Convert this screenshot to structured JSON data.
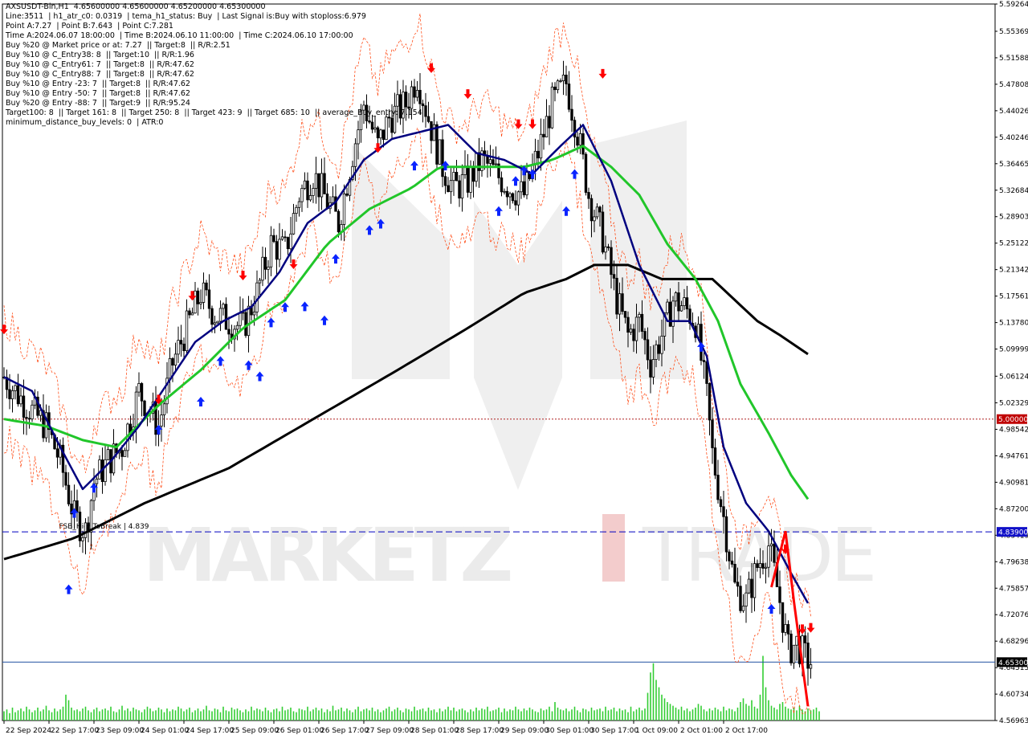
{
  "header_lines": [
    "AXSUSDT-Bin,H1  4.65600000 4.65600000 4.65200000 4.65300000",
    "Line:3511  | h1_atr_c0: 0.0319  | tema_h1_status: Buy  | Last Signal is:Buy with stoploss:6.979",
    "Point A:7.27  | Point B:7.643  | Point C:7.281",
    "Time A:2024.06.07 18:00:00  | Time B:2024.06.10 11:00:00  | Time C:2024.06.10 17:00:00",
    "Buy %20 @ Market price or at: 7.27  || Target:8  || R/R:2.51",
    "Buy %10 @ C_Entry38: 8  || Target:10  || R/R:1.96",
    "Buy %10 @ C_Entry61: 7  || Target:8  || R/R:47.62",
    "Buy %10 @ C_Entry88: 7  || Target:8  || R/R:47.62",
    "Buy %10 @ Entry -23: 7  || Target:8  || R/R:47.62",
    "Buy %10 @ Entry -50: 7  || Target:8  || R/R:47.62",
    "Buy %20 @ Entry -88: 7  || Target:9  || R/R:95.24",
    "Target100: 8  || Target 161: 8  || Target 250: 8  || Target 423: 9  || Target 685: 10  || average_Buy_entry: 7.154",
    "minimum_distance_buy_levels: 0  | ATR:0"
  ],
  "watermark": {
    "bold": "MARKETZ",
    "light": "TRADE"
  },
  "colors": {
    "background": "#ffffff",
    "grid": "#d6d6d6",
    "candle": "#000000",
    "ma_fast": "#00007f",
    "ma_mid": "#21c62a",
    "ma_slow": "#000000",
    "envelope": "#ff3b00",
    "volume": "#32cd32",
    "buy_arrow": "#0a24ff",
    "sell_arrow": "#ff0000",
    "level_5": "#b02020",
    "level_483": "#0000c0",
    "level_465": "#2050a0",
    "tag_red": "#c00000",
    "tag_blue": "#1010c8",
    "tag_black": "#000000",
    "zigzag": "#ff0000",
    "watermark": "#ebebeb",
    "watermark_accent": "#f3cccc"
  },
  "chart_data": {
    "type": "candlestick",
    "symbol": "AXSUSDT-Bin",
    "timeframe": "H1",
    "ylim": [
      4.56963,
      5.59264
    ],
    "y_ticks": [
      "5.59264",
      "5.55369",
      "5.51588",
      "5.47808",
      "5.44026",
      "5.40246",
      "5.36465",
      "5.32684",
      "5.28903",
      "5.25122",
      "5.21342",
      "5.17561",
      "5.13780",
      "5.09999",
      "5.06124",
      "5.02329",
      "4.98542",
      "4.94761",
      "4.90981",
      "4.87200",
      "4.83419",
      "4.79638",
      "4.75857",
      "4.72076",
      "4.68296",
      "4.64515",
      "4.60734",
      "4.56963"
    ],
    "x_ticks": [
      "22 Sep 2024",
      "22 Sep 17:00",
      "23 Sep 09:00",
      "24 Sep 01:00",
      "24 Sep 17:00",
      "25 Sep 09:00",
      "26 Sep 01:00",
      "26 Sep 17:00",
      "27 Sep 09:00",
      "28 Sep 01:00",
      "28 Sep 17:00",
      "29 Sep 09:00",
      "30 Sep 01:00",
      "30 Sep 17:00",
      "1 Oct 09:00",
      "2 Oct 01:00",
      "2 Oct 17:00"
    ],
    "price_path": [
      [
        0,
        5.06
      ],
      [
        8,
        5.02
      ],
      [
        15,
        4.99
      ],
      [
        20,
        4.94
      ],
      [
        25,
        4.86
      ],
      [
        29,
        4.84
      ],
      [
        32,
        4.91
      ],
      [
        37,
        4.94
      ],
      [
        42,
        4.96
      ],
      [
        48,
        5.04
      ],
      [
        55,
        4.99
      ],
      [
        60,
        5.08
      ],
      [
        65,
        5.13
      ],
      [
        70,
        5.18
      ],
      [
        75,
        5.15
      ],
      [
        80,
        5.14
      ],
      [
        85,
        5.13
      ],
      [
        90,
        5.18
      ],
      [
        95,
        5.25
      ],
      [
        100,
        5.24
      ],
      [
        105,
        5.32
      ],
      [
        110,
        5.35
      ],
      [
        115,
        5.31
      ],
      [
        119,
        5.28
      ],
      [
        124,
        5.38
      ],
      [
        128,
        5.45
      ],
      [
        133,
        5.39
      ],
      [
        137,
        5.43
      ],
      [
        143,
        5.45
      ],
      [
        147,
        5.49
      ],
      [
        151,
        5.43
      ],
      [
        156,
        5.36
      ],
      [
        160,
        5.33
      ],
      [
        165,
        5.34
      ],
      [
        170,
        5.37
      ],
      [
        175,
        5.35
      ],
      [
        180,
        5.33
      ],
      [
        185,
        5.32
      ],
      [
        190,
        5.38
      ],
      [
        195,
        5.45
      ],
      [
        200,
        5.48
      ],
      [
        204,
        5.41
      ],
      [
        208,
        5.32
      ],
      [
        213,
        5.26
      ],
      [
        218,
        5.17
      ],
      [
        222,
        5.12
      ],
      [
        226,
        5.14
      ],
      [
        230,
        5.08
      ],
      [
        235,
        5.13
      ],
      [
        238,
        5.17
      ],
      [
        242,
        5.16
      ],
      [
        246,
        5.14
      ],
      [
        250,
        5.03
      ],
      [
        252,
        4.95
      ],
      [
        256,
        4.86
      ],
      [
        260,
        4.76
      ],
      [
        264,
        4.74
      ],
      [
        268,
        4.79
      ],
      [
        272,
        4.82
      ],
      [
        276,
        4.74
      ],
      [
        279,
        4.67
      ],
      [
        282,
        4.68
      ],
      [
        285,
        4.66
      ],
      [
        287,
        4.653
      ]
    ],
    "ma_fast_pts": [
      [
        0,
        5.06
      ],
      [
        10,
        5.04
      ],
      [
        20,
        4.96
      ],
      [
        28,
        4.9
      ],
      [
        38,
        4.94
      ],
      [
        48,
        4.99
      ],
      [
        58,
        5.05
      ],
      [
        68,
        5.11
      ],
      [
        78,
        5.14
      ],
      [
        88,
        5.16
      ],
      [
        98,
        5.21
      ],
      [
        108,
        5.28
      ],
      [
        118,
        5.31
      ],
      [
        128,
        5.37
      ],
      [
        138,
        5.4
      ],
      [
        148,
        5.41
      ],
      [
        158,
        5.42
      ],
      [
        168,
        5.38
      ],
      [
        178,
        5.37
      ],
      [
        188,
        5.35
      ],
      [
        198,
        5.39
      ],
      [
        206,
        5.42
      ],
      [
        216,
        5.34
      ],
      [
        226,
        5.22
      ],
      [
        236,
        5.14
      ],
      [
        244,
        5.14
      ],
      [
        250,
        5.09
      ],
      [
        256,
        4.96
      ],
      [
        264,
        4.88
      ],
      [
        272,
        4.84
      ],
      [
        280,
        4.78
      ],
      [
        287,
        4.73
      ]
    ],
    "ma_mid_pts": [
      [
        0,
        5.0
      ],
      [
        15,
        4.99
      ],
      [
        28,
        4.97
      ],
      [
        40,
        4.96
      ],
      [
        55,
        5.02
      ],
      [
        70,
        5.07
      ],
      [
        85,
        5.13
      ],
      [
        100,
        5.17
      ],
      [
        115,
        5.25
      ],
      [
        130,
        5.3
      ],
      [
        145,
        5.33
      ],
      [
        155,
        5.36
      ],
      [
        165,
        5.36
      ],
      [
        175,
        5.36
      ],
      [
        185,
        5.36
      ],
      [
        195,
        5.37
      ],
      [
        206,
        5.39
      ],
      [
        216,
        5.36
      ],
      [
        226,
        5.32
      ],
      [
        236,
        5.25
      ],
      [
        246,
        5.2
      ],
      [
        254,
        5.14
      ],
      [
        262,
        5.05
      ],
      [
        272,
        4.98
      ],
      [
        280,
        4.92
      ],
      [
        287,
        4.88
      ]
    ],
    "ma_slow_pts": [
      [
        0,
        4.8
      ],
      [
        25,
        4.83
      ],
      [
        50,
        4.88
      ],
      [
        80,
        4.93
      ],
      [
        110,
        5.0
      ],
      [
        140,
        5.07
      ],
      [
        165,
        5.13
      ],
      [
        185,
        5.18
      ],
      [
        200,
        5.2
      ],
      [
        210,
        5.22
      ],
      [
        222,
        5.22
      ],
      [
        234,
        5.2
      ],
      [
        246,
        5.2
      ],
      [
        252,
        5.2
      ],
      [
        260,
        5.17
      ],
      [
        268,
        5.14
      ],
      [
        276,
        5.12
      ],
      [
        287,
        5.09
      ]
    ],
    "buy_arrows": [
      [
        23,
        4.757
      ],
      [
        25,
        4.866
      ],
      [
        32,
        4.902
      ],
      [
        55,
        4.985
      ],
      [
        70,
        5.025
      ],
      [
        77,
        5.083
      ],
      [
        87,
        5.077
      ],
      [
        91,
        5.061
      ],
      [
        95,
        5.138
      ],
      [
        100,
        5.16
      ],
      [
        107,
        5.161
      ],
      [
        114,
        5.141
      ],
      [
        118,
        5.229
      ],
      [
        130,
        5.27
      ],
      [
        134,
        5.279
      ],
      [
        146,
        5.362
      ],
      [
        157,
        5.362
      ],
      [
        176,
        5.297
      ],
      [
        182,
        5.34
      ],
      [
        185,
        5.355
      ],
      [
        188,
        5.35
      ],
      [
        200,
        5.297
      ],
      [
        203,
        5.35
      ],
      [
        248,
        5.103
      ],
      [
        273,
        4.729
      ]
    ],
    "sell_arrows": [
      [
        0,
        5.128
      ],
      [
        55,
        5.028
      ],
      [
        67,
        5.176
      ],
      [
        85,
        5.205
      ],
      [
        103,
        5.221
      ],
      [
        133,
        5.387
      ],
      [
        152,
        5.501
      ],
      [
        165,
        5.464
      ],
      [
        183,
        5.421
      ],
      [
        188,
        5.421
      ],
      [
        213,
        5.493
      ],
      [
        278,
        4.814
      ],
      [
        284,
        4.7
      ],
      [
        287,
        4.702
      ]
    ],
    "volume_max": 100,
    "volume": [
      10,
      12,
      8,
      14,
      9,
      11,
      13,
      10,
      15,
      12,
      9,
      11,
      14,
      10,
      12,
      16,
      11,
      9,
      13,
      10,
      12,
      15,
      28,
      22,
      14,
      11,
      12,
      10,
      13,
      15,
      11,
      9,
      12,
      14,
      10,
      12,
      13,
      11,
      15,
      10,
      9,
      12,
      16,
      11,
      13,
      10,
      14,
      12,
      11,
      9,
      12,
      15,
      13,
      10,
      11,
      14,
      12,
      9,
      13,
      10,
      12,
      11,
      15,
      13,
      10,
      12,
      14,
      9,
      11,
      13,
      10,
      12,
      16,
      11,
      10,
      13,
      12,
      9,
      15,
      11,
      10,
      14,
      12,
      13,
      11,
      9,
      12,
      10,
      15,
      11,
      13,
      12,
      10,
      14,
      11,
      9,
      12,
      13,
      10,
      15,
      11,
      12,
      14,
      10,
      9,
      13,
      12,
      11,
      15,
      10,
      12,
      14,
      11,
      13,
      9,
      12,
      10,
      16,
      11,
      12,
      14,
      10,
      13,
      11,
      9,
      12,
      15,
      10,
      12,
      13,
      11,
      14,
      10,
      12,
      9,
      11,
      13,
      15,
      10,
      12,
      14,
      11,
      9,
      13,
      12,
      10,
      15,
      11,
      12,
      13,
      10,
      14,
      11,
      12,
      9,
      13,
      10,
      12,
      15,
      11,
      14,
      10,
      12,
      13,
      11,
      9,
      12,
      10,
      14,
      11,
      13,
      12,
      15,
      10,
      11,
      12,
      14,
      9,
      13,
      10,
      12,
      11,
      15,
      12,
      10,
      13,
      11,
      14,
      12,
      10,
      9,
      13,
      11,
      12,
      15,
      10,
      20,
      14,
      12,
      11,
      13,
      10,
      12,
      15,
      11,
      9,
      13,
      12,
      10,
      14,
      11,
      12,
      13,
      10,
      15,
      11,
      12,
      14,
      10,
      13,
      11,
      12,
      9,
      15,
      10,
      12,
      14,
      11,
      13,
      30,
      52,
      62,
      44,
      36,
      28,
      24,
      20,
      18,
      16,
      14,
      12,
      15,
      11,
      13,
      10,
      12,
      14,
      18,
      16,
      12,
      10,
      13,
      11,
      14,
      12,
      10,
      15,
      11,
      13,
      12,
      10,
      14,
      20,
      24,
      18,
      16,
      22,
      15,
      13,
      28,
      70,
      36,
      22,
      16,
      14,
      12,
      18,
      20,
      15,
      13,
      12,
      14,
      11,
      16,
      12,
      10,
      13,
      11,
      12,
      14,
      10
    ],
    "level_lines": [
      {
        "price": 5.0,
        "tag": "5.00000",
        "style": "dotted",
        "color_key": "level_5",
        "tag_key": "tag_red"
      },
      {
        "price": 4.839,
        "tag": "4.83900",
        "style": "dashed",
        "color_key": "level_483",
        "tag_key": "tag_blue"
      },
      {
        "price": 4.653,
        "tag": "4.65300",
        "style": "solid",
        "color_key": "level_465",
        "tag_key": "tag_black"
      }
    ],
    "level_label": {
      "text": "FSB_HighToBreak | 4.839",
      "bar": 23
    }
  }
}
